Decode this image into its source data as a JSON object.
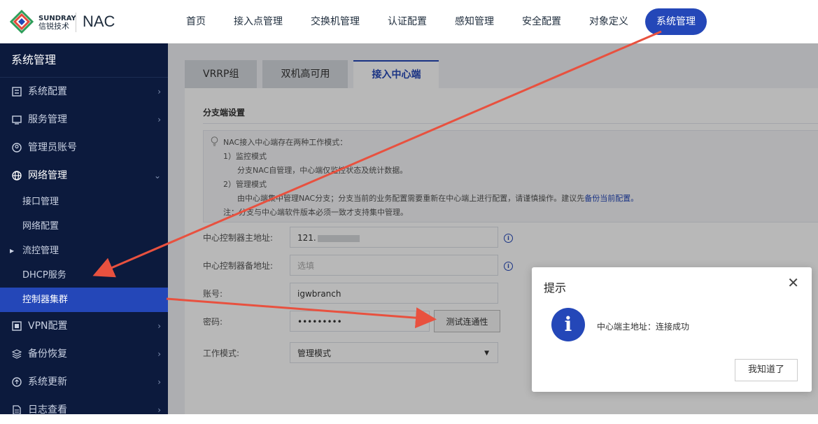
{
  "header": {
    "brand_en": "SUNDRAY",
    "brand_cn": "信锐技术",
    "product": "NAC",
    "nav": [
      "首页",
      "接入点管理",
      "交换机管理",
      "认证配置",
      "感知管理",
      "安全配置",
      "对象定义",
      "系统管理"
    ],
    "active_nav": "系统管理"
  },
  "sidebar": {
    "title": "系统管理",
    "items": [
      {
        "label": "系统配置",
        "icon": "system-config-icon"
      },
      {
        "label": "服务管理",
        "icon": "service-icon"
      },
      {
        "label": "管理员账号",
        "icon": "admin-user-icon"
      },
      {
        "label": "网络管理",
        "icon": "network-icon"
      }
    ],
    "network_sub": [
      "接口管理",
      "网络配置",
      "流控管理",
      "DHCP服务",
      "控制器集群"
    ],
    "items_after": [
      {
        "label": "VPN配置",
        "icon": "vpn-icon"
      },
      {
        "label": "备份恢复",
        "icon": "backup-icon"
      },
      {
        "label": "系统更新",
        "icon": "update-icon"
      },
      {
        "label": "日志查看",
        "icon": "log-icon"
      }
    ]
  },
  "tabs": [
    "VRRP组",
    "双机高可用",
    "接入中心端"
  ],
  "section": {
    "title": "分支端设置"
  },
  "notice": {
    "line1": "NAC接入中心端存在两种工作模式：",
    "line2": "1）监控模式",
    "line3": "分支NAC自管理，中心端仅监控状态及统计数据。",
    "line4": "2）管理模式",
    "line5": "由中心端集中管理NAC分支；分支当前的业务配置需要重新在中心端上进行配置，请谨慎操作。建议先",
    "link": "备份当前配置。",
    "line6": "注：分支与中心端软件版本必须一致才支持集中管理。"
  },
  "form": {
    "primary_label": "中心控制器主地址:",
    "primary_value": "121.",
    "backup_label": "中心控制器备地址:",
    "backup_placeholder": "选填",
    "account_label": "账号:",
    "account_value": "igwbranch",
    "password_label": "密码:",
    "password_value": "•••••••••",
    "test_button": "测试连通性",
    "mode_label": "工作模式:",
    "mode_value": "管理模式"
  },
  "dialog": {
    "title": "提示",
    "message": "中心端主地址：连接成功",
    "ok": "我知道了"
  },
  "colors": {
    "accent": "#2447b8",
    "sidebar": "#0c1a3d",
    "annotation": "#e8513f"
  }
}
